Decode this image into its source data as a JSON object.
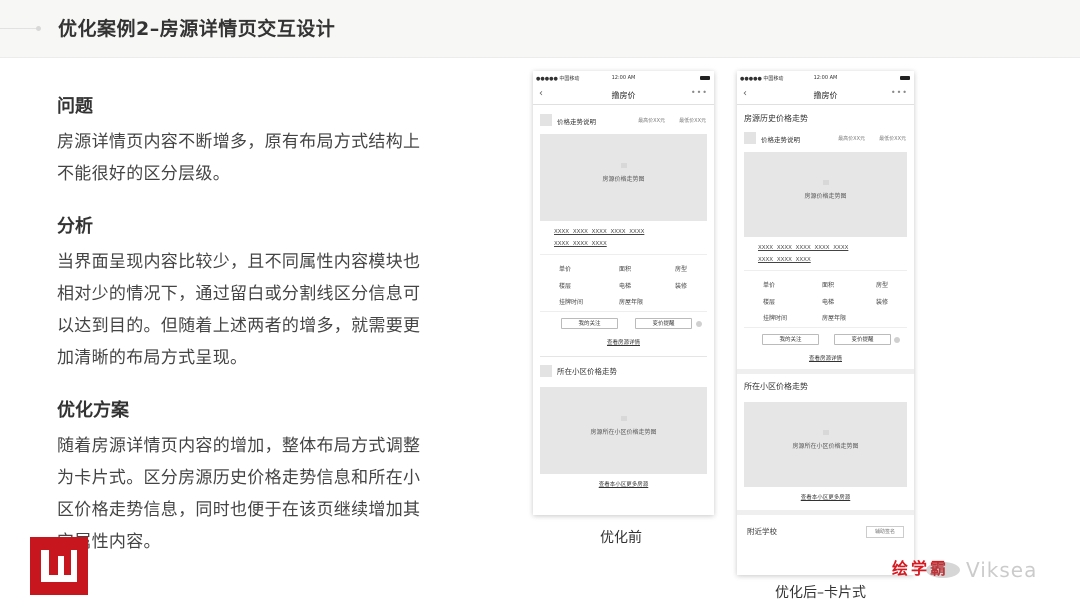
{
  "header": {
    "title": "优化案例2–房源详情页交互设计"
  },
  "sections": [
    {
      "title": "问题",
      "body": "房源详情页内容不断增多，原有布局方式结构上不能很好的区分层级。"
    },
    {
      "title": "分析",
      "body": "当界面呈现内容比较少，且不同属性内容模块也相对少的情况下，通过留白或分割线区分信息可以达到目的。但随着上述两者的增多，就需要更加清晰的布局方式呈现。"
    },
    {
      "title": "优化方案",
      "body": "随着房源详情页内容的增加，整体布局方式调整为卡片式。区分房源历史价格走势信息和所在小区价格走势信息，同时也便于在该页继续增加其它属性内容。"
    }
  ],
  "phone": {
    "carrier": "●●●●● 中国移动",
    "time": "12:00 AM",
    "nav_title": "撸房价",
    "module_label": "价格走势说明",
    "high_price": "最高价XX元",
    "low_price": "最低价XX元",
    "chart1": "房源价格走势图",
    "xxx_line1": "XXXX XXXX XXXX XXXX XXXX",
    "xxx_line2": "XXXX XXXX XXXX",
    "attr_unit_price": "单价",
    "attr_area": "面积",
    "attr_type": "房型",
    "attr_floor": "楼层",
    "attr_elevator": "电梯",
    "attr_decor": "装修",
    "attr_listed": "挂牌时间",
    "attr_year": "房屋年限",
    "btn_follow": "我的关注",
    "btn_notify": "变价提醒",
    "link_detail": "查看房源详情",
    "community_label": "所在小区价格走势",
    "chart2": "房源所在小区价格走势图",
    "link_more": "查看本小区更多房源",
    "history_title": "房源历史价格走势",
    "school_label": "附近学校",
    "school_btn": "辅助签名"
  },
  "captions": {
    "before": "优化前",
    "after": "优化后–卡片式"
  },
  "watermark": {
    "brand": "绘学霸",
    "name": "Viksea"
  }
}
